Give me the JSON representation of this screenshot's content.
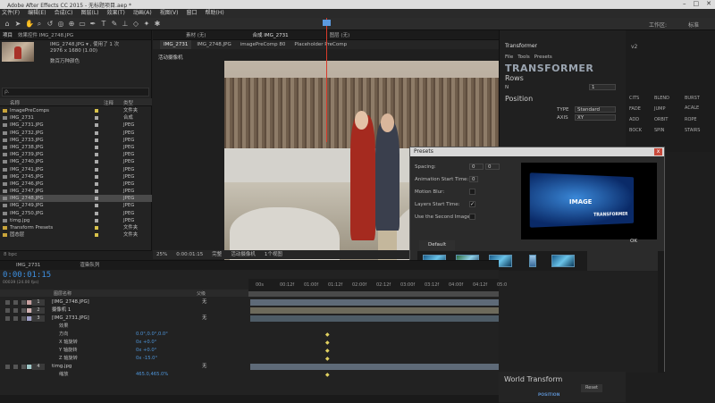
{
  "window": {
    "title": "Adobe After Effects CC 2015 - 无标题项目.aep *"
  },
  "menu": [
    "文件(F)",
    "编辑(E)",
    "合成(C)",
    "图层(L)",
    "效果(T)",
    "动画(A)",
    "视图(V)",
    "窗口",
    "帮助(H)"
  ],
  "toolbar": {
    "workspace_label": "工作区:",
    "workspace_value": "标准"
  },
  "project": {
    "tabs": [
      "项目",
      "效果控件 IMG_2748.JPG"
    ],
    "selected_name": "IMG_2748.JPG ▾ , 使用了 1 次",
    "selected_size": "2976 x 1680 (1.00)",
    "selected_extra": "数百万种颜色",
    "search_placeholder": "ρ.",
    "col_name": "名称",
    "col_label": "注释",
    "col_type": "类型",
    "files": [
      {
        "name": "ImagePreComps",
        "type": "文件夹",
        "folder": true
      },
      {
        "name": "IMG_2731",
        "type": "合成",
        "folder": false
      },
      {
        "name": "IMG_2731.JPG",
        "type": "JPEG",
        "folder": false
      },
      {
        "name": "IMG_2732.JPG",
        "type": "JPEG",
        "folder": false
      },
      {
        "name": "IMG_2733.JPG",
        "type": "JPEG",
        "folder": false
      },
      {
        "name": "IMG_2738.JPG",
        "type": "JPEG",
        "folder": false
      },
      {
        "name": "IMG_2739.JPG",
        "type": "JPEG",
        "folder": false
      },
      {
        "name": "IMG_2740.JPG",
        "type": "JPEG",
        "folder": false
      },
      {
        "name": "IMG_2741.JPG",
        "type": "JPEG",
        "folder": false
      },
      {
        "name": "IMG_2745.JPG",
        "type": "JPEG",
        "folder": false
      },
      {
        "name": "IMG_2746.JPG",
        "type": "JPEG",
        "folder": false
      },
      {
        "name": "IMG_2747.JPG",
        "type": "JPEG",
        "folder": false
      },
      {
        "name": "IMG_2748.JPG",
        "type": "JPEG",
        "folder": false,
        "selected": true
      },
      {
        "name": "IMG_2749.JPG",
        "type": "JPEG",
        "folder": false
      },
      {
        "name": "IMG_2750.JPG",
        "type": "JPEG",
        "folder": false
      },
      {
        "name": "timg.jpg",
        "type": "JPEG",
        "folder": false
      },
      {
        "name": "Transform Presets",
        "type": "文件夹",
        "folder": true
      },
      {
        "name": "固态层",
        "type": "文件夹",
        "folder": true
      }
    ],
    "bpc": "8 bpc"
  },
  "comp": {
    "tabs": [
      "素材 (无)",
      "合成 IMG_2731",
      "图层 (无)"
    ],
    "subtabs": [
      "IMG_2731",
      "IMG_2748.JPG",
      "imagePreComp 80",
      "Placeholder PreComp"
    ],
    "camera_label": "活动摄像机",
    "footer": [
      "25%",
      "0:00:01:15",
      "完整",
      "活动摄像机",
      "1个视图"
    ]
  },
  "transformer": {
    "title": "Transformer",
    "menu": [
      "File",
      "Tools",
      "Presets"
    ],
    "logo": "TRANSFORMER",
    "rows_heading": "Rows",
    "n_label": "N",
    "n_value": "1",
    "position_heading": "Position",
    "type_label": "TYPE",
    "type_value": "Standard",
    "axis_label": "AXIS",
    "axis_value": "XY"
  },
  "effects": {
    "labels": [
      "v2",
      "CITS",
      "BLEND",
      "BURST",
      "ACALE",
      "JUMP",
      "FADE",
      "ADD",
      "ORBIT",
      "ROPE",
      "BOCK",
      "SPIN",
      "STAIRS"
    ]
  },
  "presets": {
    "title": "Presets",
    "close": "x",
    "spacing_label": "Spacing:",
    "spacing_x": "0",
    "spacing_y": "0",
    "anim_start_label": "Animation Start Time:",
    "anim_start_value": "0",
    "motion_blur_label": "Motion Blur:",
    "layers_start_label": "Layers Start Time:",
    "use_second_label": "Use the Second Image:",
    "check_mark": "✓",
    "preview_image_text": "IMAGE",
    "preview_logo": "TRANSFORMER",
    "ok_label": "OK",
    "default_tab": "Default"
  },
  "world_transform": {
    "title": "World Transform",
    "position_label": "POSITION",
    "reset_label": "Reset"
  },
  "timeline": {
    "tabs": [
      "IMG_2731",
      "渲染队列"
    ],
    "timecode": "0:00:01:15",
    "fps": "00039 (24.00 fps)",
    "col_layer": "图层名称",
    "col_parent": "父级",
    "ruler": [
      "00s",
      "00:12f",
      "01:00f",
      "01:12f",
      "02:00f",
      "02:12f",
      "03:00f",
      "03:12f",
      "04:00f",
      "04:12f",
      "05:0"
    ],
    "layers": [
      {
        "num": "1",
        "name": "[IMG_2748.JPG]",
        "parent": "无",
        "color": "#c8a0a0"
      },
      {
        "num": "2",
        "name": "摄像机 1",
        "parent": "",
        "color": "#d0b0b0"
      },
      {
        "num": "3",
        "name": "[IMG_2731.JPG]",
        "parent": "无",
        "color": "#a0a0c8"
      }
    ],
    "effect_group": "效果",
    "props": [
      {
        "name": "方向",
        "value": "0.0°,0.0°,0.0°"
      },
      {
        "name": "X 轴旋转",
        "value": "0x +0.0°"
      },
      {
        "name": "Y 轴旋转",
        "value": "0x +0.0°"
      },
      {
        "name": "Z 轴旋转",
        "value": "0x -15.0°"
      }
    ],
    "layer4": {
      "num": "4",
      "name": "timg.jpg",
      "parent": "无",
      "color": "#a0c8c8"
    },
    "scale_label": "缩放",
    "scale_value": "465.0,465.0%"
  }
}
